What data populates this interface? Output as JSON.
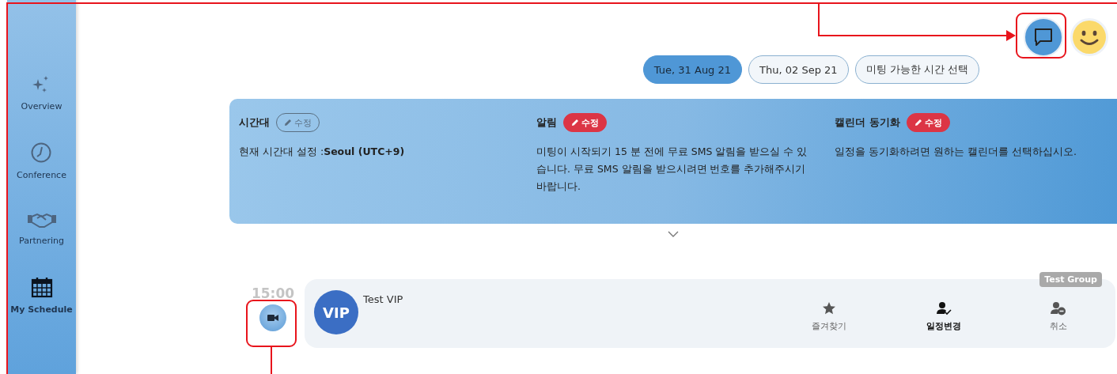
{
  "sidebar": {
    "items": [
      {
        "label": "Overview",
        "kind": "sparkles",
        "selected": false
      },
      {
        "label": "Conference",
        "kind": "clock",
        "selected": false
      },
      {
        "label": "Partnering",
        "kind": "handshake",
        "selected": false
      },
      {
        "label": "My Schedule",
        "kind": "calendar",
        "selected": true
      }
    ]
  },
  "date_tabs": [
    {
      "label": "Tue, 31 Aug 21",
      "selected": true
    },
    {
      "label": "Thu, 02 Sep 21",
      "selected": false
    },
    {
      "label": "미팅 가능한 시간 선택",
      "selected": false
    }
  ],
  "settings_panel": {
    "sections": [
      {
        "title": "시간대",
        "edit": {
          "label": "수정",
          "kind": "outline"
        },
        "text": "현재 시간대 설정 :**Seoul (UTC+9)**"
      },
      {
        "title": "알림",
        "edit": {
          "label": "수정",
          "kind": "solid"
        },
        "text": "미팅이 시작되기 15 분 전에 무료 SMS 알림을 받으실 수 있습니다. 무료 SMS 알림을 받으시려면 번호를 추가해주시기 바랍니다."
      },
      {
        "title": "캘린더 동기화",
        "edit": {
          "label": "수정",
          "kind": "solid"
        },
        "text": "일정을 동기화하려면 원하는 캘린더를 선택하십시오."
      }
    ]
  },
  "schedule": [
    {
      "time": "15:00",
      "avatar": "VIP",
      "name": "Test VIP",
      "group": "Test Group",
      "actions": [
        {
          "label": "즐겨찾기",
          "kind": "star",
          "emphasized": false
        },
        {
          "label": "일정변경",
          "kind": "reschedule",
          "emphasized": true
        },
        {
          "label": "취소",
          "kind": "cancel",
          "emphasized": false
        }
      ]
    }
  ]
}
